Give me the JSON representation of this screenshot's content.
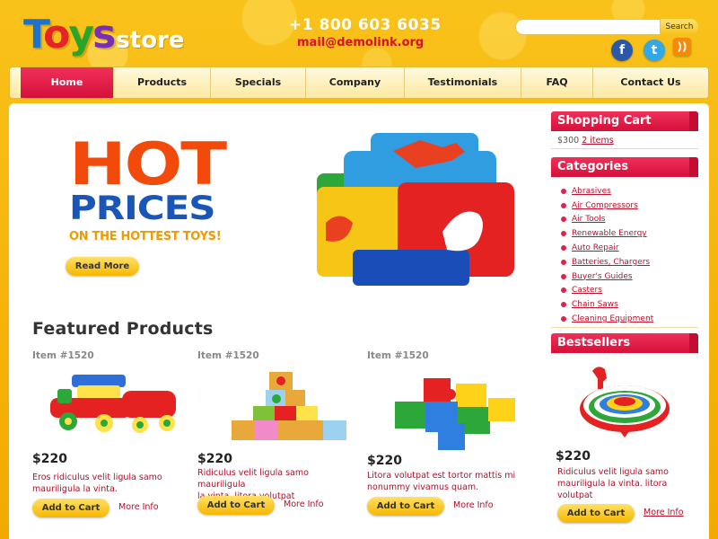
{
  "header": {
    "logo": {
      "letters": [
        "T",
        "o",
        "y",
        "s"
      ],
      "suffix": "store"
    },
    "phone": "+1 800 603 6035",
    "email": "mail@demolink.org",
    "search": {
      "placeholder": "",
      "button": "Search"
    },
    "social": [
      {
        "name": "facebook",
        "glyph": "f"
      },
      {
        "name": "twitter",
        "glyph": "t"
      },
      {
        "name": "rss",
        "glyph": "))"
      }
    ]
  },
  "nav": {
    "items": [
      {
        "label": "Home",
        "active": true
      },
      {
        "label": "Products",
        "active": false
      },
      {
        "label": "Specials",
        "active": false
      },
      {
        "label": "Company",
        "active": false
      },
      {
        "label": "Testimonials",
        "active": false
      },
      {
        "label": "FAQ",
        "active": false
      },
      {
        "label": "Contact Us",
        "active": false
      }
    ]
  },
  "hero": {
    "line1": "HOT",
    "line2": "PRICES",
    "tagline": "ON THE HOTTEST TOYS!",
    "button": "Read More"
  },
  "featured": {
    "title": "Featured Products",
    "products": [
      {
        "item": "Item #1520",
        "price": "$220",
        "desc_line1": "Eros ridiculus velit ligula samo",
        "desc_line2": "mauriligula la vinta.",
        "cart": "Add to Cart",
        "more": "More Info",
        "image": "toy-train"
      },
      {
        "item": "Item #1520",
        "price": "$220",
        "desc_line1": "Ridiculus velit ligula samo mauriligula",
        "desc_line2": "la vinta. litora volutpat",
        "cart": "Add to Cart",
        "more": "More Info",
        "image": "letter-blocks"
      },
      {
        "item": "Item #1520",
        "price": "$220",
        "desc_line1": "Litora volutpat est tortor mattis mi",
        "desc_line2": "nonummy vivamus quam.",
        "cart": "Add to Cart",
        "more": "More Info",
        "image": "puzzle-pieces"
      }
    ]
  },
  "sidebar": {
    "cart": {
      "title": "Shopping Cart",
      "total": "$300",
      "items": "2 items"
    },
    "categories": {
      "title": "Categories",
      "items": [
        "Abrasives",
        "Air Compressors",
        "Air Tools",
        "Renewable Energy",
        "Auto Repair",
        "Batteries, Chargers",
        "Buyer's Guides",
        "Casters",
        "Chain Saws",
        "Cleaning Equipment"
      ]
    },
    "bestsellers": {
      "title": "Bestsellers",
      "price": "$220",
      "desc_line1": "Ridiculus velit ligula samo",
      "desc_line2": "mauriligula la vinta. litora",
      "desc_line3": "volutpat",
      "cart": "Add to Cart",
      "more": "More Info",
      "image": "spinning-top"
    }
  },
  "colors": {
    "accent": "#d5103a",
    "background": "#f7b500",
    "link": "#b0102a"
  }
}
